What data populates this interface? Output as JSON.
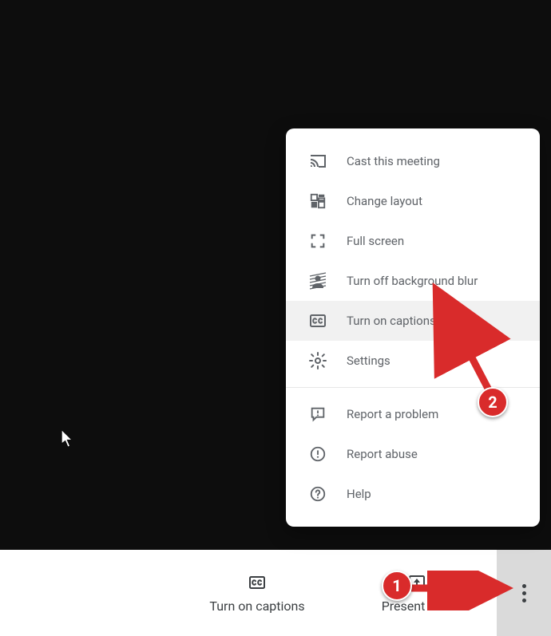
{
  "menu": {
    "items": [
      {
        "label": "Cast this meeting"
      },
      {
        "label": "Change layout"
      },
      {
        "label": "Full screen"
      },
      {
        "label": "Turn off background blur"
      },
      {
        "label": "Turn on captions"
      },
      {
        "label": "Settings"
      },
      {
        "label": "Report a problem"
      },
      {
        "label": "Report abuse"
      },
      {
        "label": "Help"
      }
    ]
  },
  "toolbar": {
    "captions_label": "Turn on captions",
    "present_label": "Present now"
  },
  "annotations": {
    "step1": "1",
    "step2": "2"
  }
}
